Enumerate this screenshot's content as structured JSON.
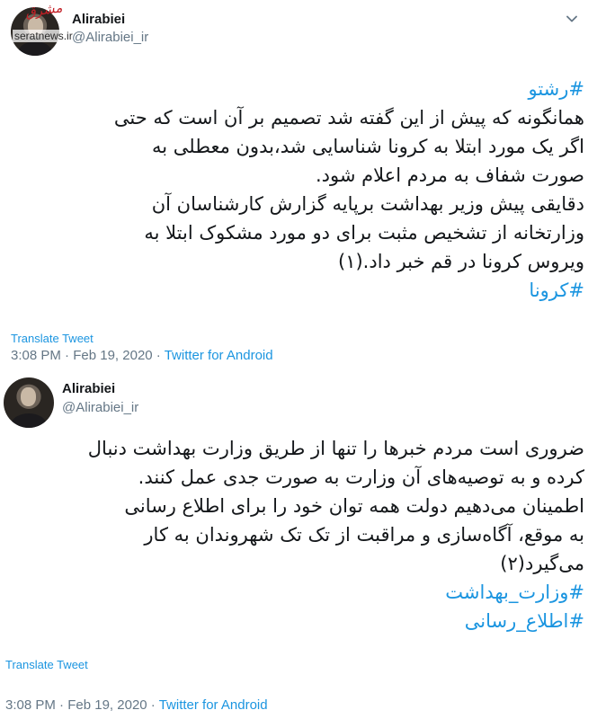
{
  "tweets": [
    {
      "author": {
        "name": "Alirabiei",
        "handle": "@Alirabiei_ir"
      },
      "watermark": {
        "overlay": "مشرق",
        "site": "seratnews.ir"
      },
      "lines": [
        {
          "text": "#رشتو",
          "hashtag": true
        },
        {
          "text": "همانگونه که پیش از این گفته شد تصمیم بر آن است که حتی",
          "hashtag": false
        },
        {
          "text": "اگر یک مورد ابتلا به کرونا شناسایی شد،بدون معطلی به",
          "hashtag": false
        },
        {
          "text": "صورت شفاف به مردم اعلام شود.",
          "hashtag": false
        },
        {
          "text": "دقایقی پیش وزیر بهداشت برپایه گزارش کارشناسان آن",
          "hashtag": false
        },
        {
          "text": "وزارتخانه از تشخیص مثبت برای دو مورد مشکوک ابتلا به",
          "hashtag": false
        },
        {
          "text": "ویروس کرونا در قم خبر داد.(۱)",
          "hashtag": false
        },
        {
          "text": "#کرونا",
          "hashtag": true
        }
      ],
      "translate_label": "Translate Tweet",
      "time": "3:08 PM",
      "date": "Feb 19, 2020",
      "separator": "·",
      "source": "Twitter for Android"
    },
    {
      "author": {
        "name": "Alirabiei",
        "handle": "@Alirabiei_ir"
      },
      "lines": [
        {
          "text": "ضروری است مردم خبرها را تنها از طریق وزارت بهداشت دنبال",
          "hashtag": false
        },
        {
          "text": "کرده و به توصیه‌های آن وزارت به صورت جدی عمل کنند.",
          "hashtag": false
        },
        {
          "text": "اطمینان می‌دهیم دولت همه توان خود را برای اطلاع رسانی",
          "hashtag": false
        },
        {
          "text": "به موقع، آگاه‌سازی و مراقبت از تک تک شهروندان به کار",
          "hashtag": false
        },
        {
          "text": "می‌گیرد(۲)",
          "hashtag": false
        },
        {
          "text": "#وزارت_بهداشت",
          "hashtag": true
        },
        {
          "text": "#اطلاع_رسانی",
          "hashtag": true
        }
      ],
      "translate_label": "Translate Tweet",
      "time": "3:08 PM",
      "date": "Feb 19, 2020",
      "separator": "·",
      "source": "Twitter for Android"
    }
  ],
  "colors": {
    "link": "#1b95e0",
    "secondary": "#657786",
    "text": "#14171a"
  },
  "icons": {
    "menu": "chevron-down-icon"
  }
}
